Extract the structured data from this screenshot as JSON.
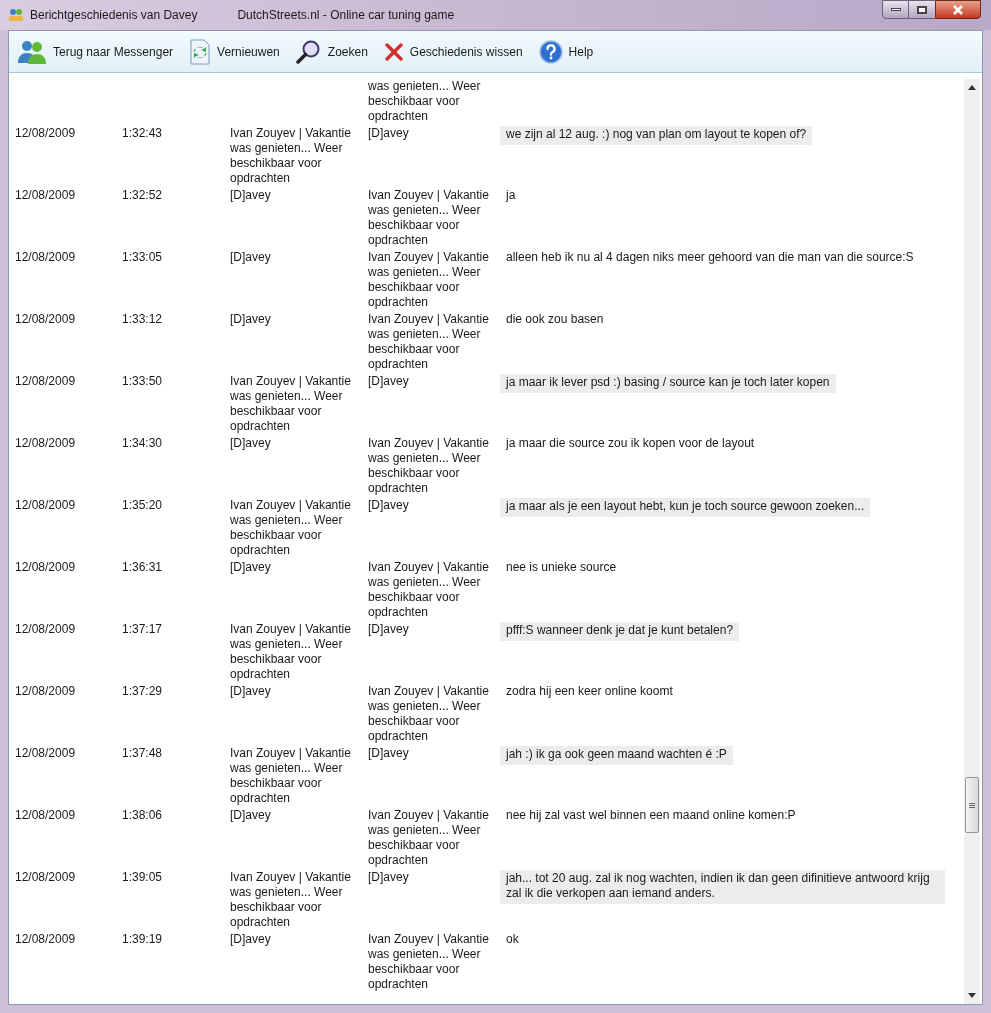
{
  "window": {
    "title": "Berichtgeschiedenis van Davey",
    "subtitle": "DutchStreets.nl - Online car tuning game"
  },
  "toolbar": [
    {
      "kind": "contacts",
      "label": "Terug naar Messenger"
    },
    {
      "kind": "refresh",
      "label": "Vernieuwen"
    },
    {
      "kind": "search",
      "label": "Zoeken"
    },
    {
      "kind": "delete",
      "label": "Geschiedenis wissen"
    },
    {
      "kind": "help",
      "label": "Help"
    }
  ],
  "clipped_top": {
    "text": "was genieten... Weer beschikbaar voor opdrachten"
  },
  "messages": [
    {
      "date": "12/08/2009",
      "time": "1:32:43",
      "from": "Ivan Zouyev | Vakantie was genieten... Weer beschikbaar voor opdrachten",
      "to": "[D]avey",
      "text": "we zijn al 12 aug. :) nog van plan om layout te kopen of?",
      "shaded": true
    },
    {
      "date": "12/08/2009",
      "time": "1:32:52",
      "from": "[D]avey",
      "to": "Ivan Zouyev | Vakantie was genieten... Weer beschikbaar voor opdrachten",
      "text": "ja",
      "shaded": false
    },
    {
      "date": "12/08/2009",
      "time": "1:33:05",
      "from": "[D]avey",
      "to": "Ivan Zouyev | Vakantie was genieten... Weer beschikbaar voor opdrachten",
      "text": "alleen heb ik nu al 4 dagen niks meer gehoord van die man van die source:S",
      "shaded": false
    },
    {
      "date": "12/08/2009",
      "time": "1:33:12",
      "from": "[D]avey",
      "to": "Ivan Zouyev | Vakantie was genieten... Weer beschikbaar voor opdrachten",
      "text": "die ook zou basen",
      "shaded": false
    },
    {
      "date": "12/08/2009",
      "time": "1:33:50",
      "from": "Ivan Zouyev | Vakantie was genieten... Weer beschikbaar voor opdrachten",
      "to": "[D]avey",
      "text": "ja maar ik lever psd :) basing / source kan je toch later kopen",
      "shaded": true
    },
    {
      "date": "12/08/2009",
      "time": "1:34:30",
      "from": "[D]avey",
      "to": "Ivan Zouyev | Vakantie was genieten... Weer beschikbaar voor opdrachten",
      "text": "ja maar die source zou ik kopen voor de layout",
      "shaded": false
    },
    {
      "date": "12/08/2009",
      "time": "1:35:20",
      "from": "Ivan Zouyev | Vakantie was genieten... Weer beschikbaar voor opdrachten",
      "to": "[D]avey",
      "text": "ja maar als je een layout hebt, kun je toch source gewoon zoeken...",
      "shaded": true
    },
    {
      "date": "12/08/2009",
      "time": "1:36:31",
      "from": "[D]avey",
      "to": "Ivan Zouyev | Vakantie was genieten... Weer beschikbaar voor opdrachten",
      "text": "nee is unieke source",
      "shaded": false
    },
    {
      "date": "12/08/2009",
      "time": "1:37:17",
      "from": "Ivan Zouyev | Vakantie was genieten... Weer beschikbaar voor opdrachten",
      "to": "[D]avey",
      "text": "pfff:S wanneer denk je dat je kunt betalen?",
      "shaded": true
    },
    {
      "date": "12/08/2009",
      "time": "1:37:29",
      "from": "[D]avey",
      "to": "Ivan Zouyev | Vakantie was genieten... Weer beschikbaar voor opdrachten",
      "text": "zodra hij een keer online koomt",
      "shaded": false
    },
    {
      "date": "12/08/2009",
      "time": "1:37:48",
      "from": "Ivan Zouyev | Vakantie was genieten... Weer beschikbaar voor opdrachten",
      "to": "[D]avey",
      "text": "jah :) ik ga ook geen maand wachten é :P",
      "shaded": true
    },
    {
      "date": "12/08/2009",
      "time": "1:38:06",
      "from": "[D]avey",
      "to": "Ivan Zouyev | Vakantie was genieten... Weer beschikbaar voor opdrachten",
      "text": "nee hij zal vast wel binnen een maand online komen:P",
      "shaded": false
    },
    {
      "date": "12/08/2009",
      "time": "1:39:05",
      "from": "Ivan Zouyev | Vakantie was genieten... Weer beschikbaar voor opdrachten",
      "to": "[D]avey",
      "text": "jah... tot 20 aug. zal ik nog wachten, indien ik dan geen difinitieve antwoord krijg zal ik die verkopen aan iemand anders.",
      "shaded": true
    },
    {
      "date": "12/08/2009",
      "time": "1:39:19",
      "from": "[D]avey",
      "to": "Ivan Zouyev | Vakantie was genieten... Weer beschikbaar voor opdrachten",
      "text": "ok",
      "shaded": false
    }
  ]
}
